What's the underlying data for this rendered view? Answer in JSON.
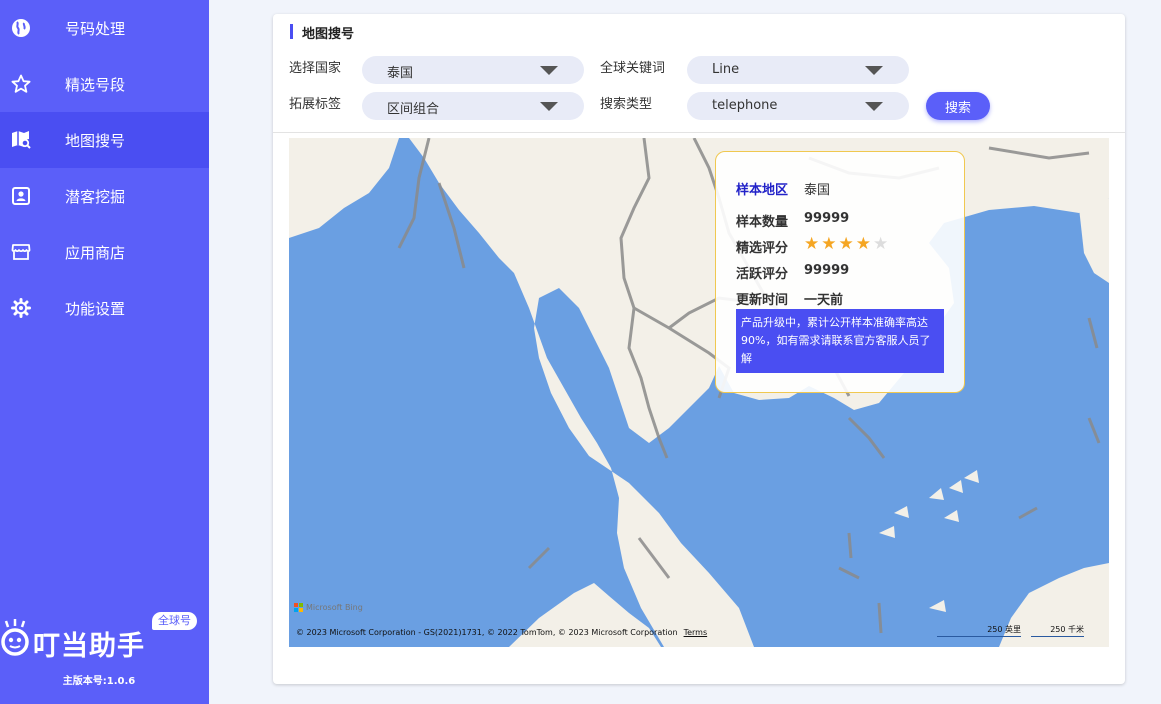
{
  "sidebar": {
    "items": [
      {
        "label": "号码处理",
        "icon": "globe-icon"
      },
      {
        "label": "精选号段",
        "icon": "star-icon"
      },
      {
        "label": "地图搜号",
        "icon": "map-search-icon"
      },
      {
        "label": "潜客挖掘",
        "icon": "contact-card-icon"
      },
      {
        "label": "应用商店",
        "icon": "store-icon"
      },
      {
        "label": "功能设置",
        "icon": "gear-icon"
      }
    ],
    "active_index": 2,
    "brand_name": "叮当助手",
    "brand_badge": "全球号",
    "version": "主版本号:1.0.6"
  },
  "panel": {
    "title": "地图搜号",
    "country_label": "选择国家",
    "country_value": "泰国",
    "keyword_label": "全球关键词",
    "keyword_value": "Line",
    "tag_label": "拓展标签",
    "tag_value": "区间组合",
    "search_type_label": "搜索类型",
    "search_type_value": "telephone",
    "search_button": "搜索"
  },
  "popup": {
    "region_label": "样本地区",
    "region_value": "泰国",
    "count_label": "样本数量",
    "count_value": "99999",
    "rating_label": "精选评分",
    "rating_value": 4,
    "rating_max": 5,
    "activity_label": "活跃评分",
    "activity_value": "99999",
    "update_label": "更新时间",
    "update_value": "一天前",
    "notice": "产品升级中，累计公开样本准确率高达90%，如有需求请联系官方客服人员了解"
  },
  "map": {
    "logo": "Microsoft Bing",
    "copyright": "© 2023 Microsoft Corporation - GS(2021)1731, © 2022 TomTom, © 2023 Microsoft Corporation",
    "terms": "Terms",
    "scale_miles": "250 英里",
    "scale_km": "250 千米"
  },
  "colors": {
    "sidebar": "#5b5ff9",
    "sidebar_active": "#4a4ef2",
    "accent": "#4a4ef2",
    "star_on": "#f5a623",
    "star_off": "#dddddd",
    "sea": "#6a9fe2",
    "land": "#f3f0e8"
  }
}
